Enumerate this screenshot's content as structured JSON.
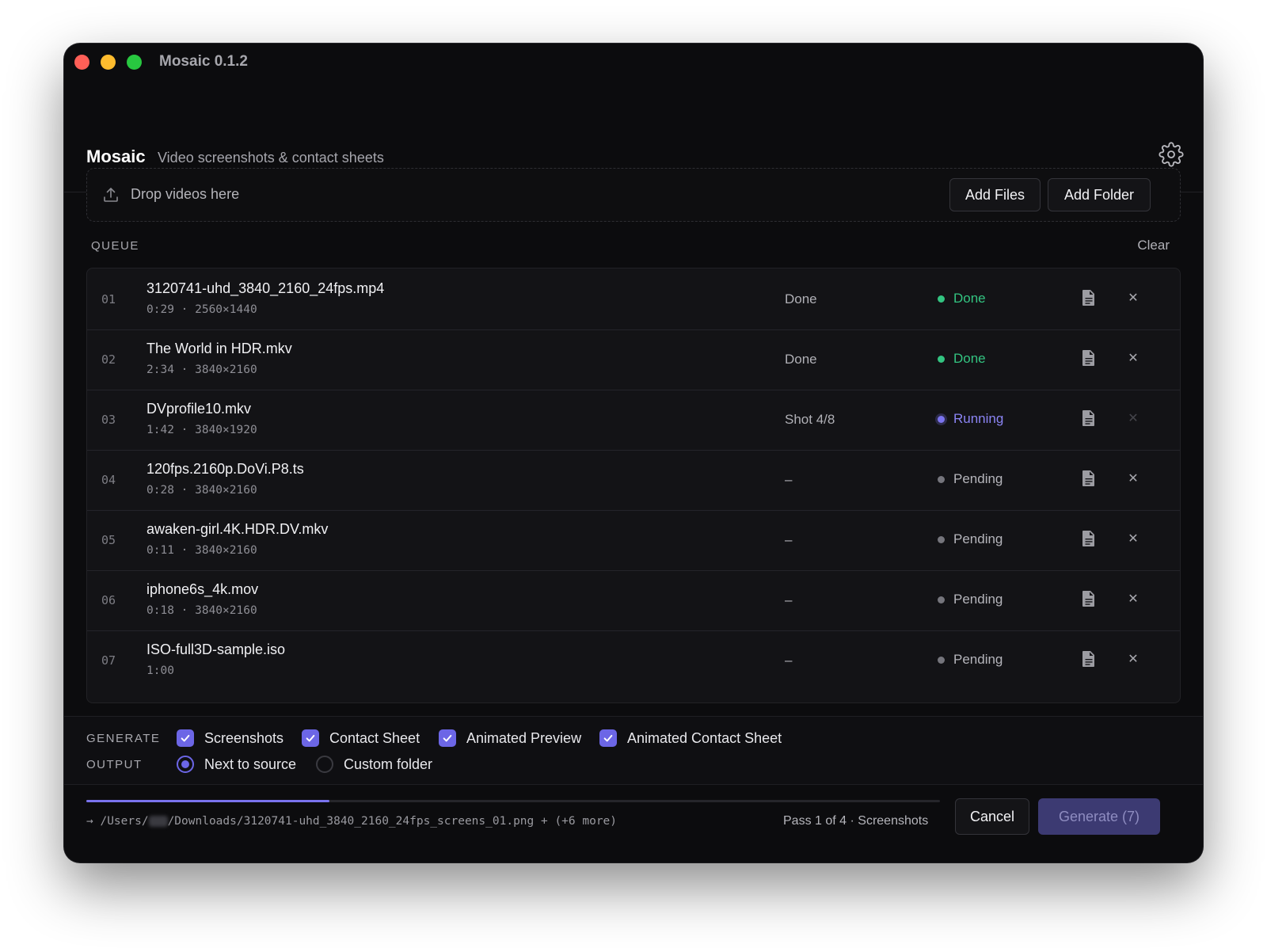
{
  "window": {
    "title": "Mosaic 0.1.2"
  },
  "header": {
    "app_name": "Mosaic",
    "subtitle": "Video screenshots & contact sheets",
    "settings_icon": "gear-icon"
  },
  "dropzone": {
    "text": "Drop videos here",
    "icon": "upload-icon",
    "add_files_label": "Add Files",
    "add_folder_label": "Add Folder"
  },
  "queue": {
    "label": "QUEUE",
    "clear_label": "Clear",
    "rows": [
      {
        "index": "01",
        "name": "3120741-uhd_3840_2160_24fps.mp4",
        "meta": "0:29 · 2560×1440",
        "progress": "Done",
        "status": "Done",
        "state": "done"
      },
      {
        "index": "02",
        "name": "The World in HDR.mkv",
        "meta": "2:34 · 3840×2160",
        "progress": "Done",
        "status": "Done",
        "state": "done"
      },
      {
        "index": "03",
        "name": "DVprofile10.mkv",
        "meta": "1:42 · 3840×1920",
        "progress": "Shot 4/8",
        "status": "Running",
        "state": "running"
      },
      {
        "index": "04",
        "name": "120fps.2160p.DoVi.P8.ts",
        "meta": "0:28 · 3840×2160",
        "progress": "–",
        "status": "Pending",
        "state": "pending"
      },
      {
        "index": "05",
        "name": "awaken-girl.4K.HDR.DV.mkv",
        "meta": "0:11 · 3840×2160",
        "progress": "–",
        "status": "Pending",
        "state": "pending"
      },
      {
        "index": "06",
        "name": "iphone6s_4k.mov",
        "meta": "0:18 · 3840×2160",
        "progress": "–",
        "status": "Pending",
        "state": "pending"
      },
      {
        "index": "07",
        "name": "ISO-full3D-sample.iso",
        "meta": "1:00",
        "progress": "–",
        "status": "Pending",
        "state": "pending"
      }
    ]
  },
  "generate": {
    "label": "GENERATE",
    "options": [
      {
        "label": "Screenshots",
        "checked": true
      },
      {
        "label": "Contact Sheet",
        "checked": true
      },
      {
        "label": "Animated Preview",
        "checked": true
      },
      {
        "label": "Animated Contact Sheet",
        "checked": true
      }
    ]
  },
  "output": {
    "label": "OUTPUT",
    "options": [
      {
        "label": "Next to source",
        "selected": true
      },
      {
        "label": "Custom folder",
        "selected": false
      }
    ]
  },
  "footer": {
    "progress_fraction": 0.285,
    "path_prefix": "→ /Users/",
    "path_suffix": "/Downloads/3120741-uhd_3840_2160_24fps_screens_01.png + (+6 more)",
    "pass_text": "Pass 1 of 4 · Screenshots",
    "cancel_label": "Cancel",
    "generate_label": "Generate (7)"
  },
  "colors": {
    "accent": "#6c66e6",
    "done": "#33c481",
    "running": "#8b84f4",
    "pending": "#75757c",
    "background": "#0c0c0e"
  }
}
